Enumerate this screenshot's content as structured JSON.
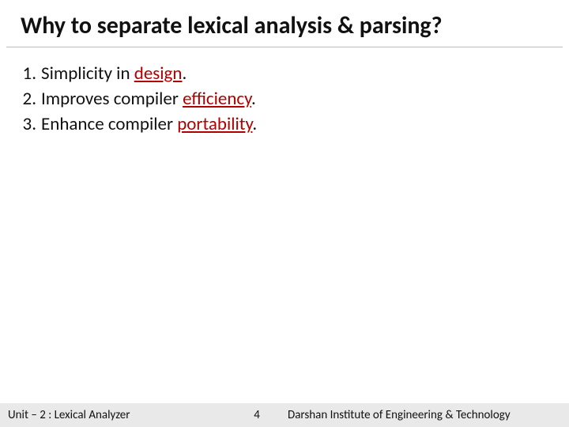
{
  "title": "Why to separate lexical analysis & parsing?",
  "items": [
    {
      "num": "1.",
      "pre": "Simplicity in ",
      "accent": "design",
      "post": "."
    },
    {
      "num": "2.",
      "pre": "Improves compiler ",
      "accent": "efficiency",
      "post": "."
    },
    {
      "num": "3.",
      "pre": "Enhance compiler ",
      "accent": "portability",
      "post": "."
    }
  ],
  "footer": {
    "left": "Unit – 2 : Lexical Analyzer",
    "page": "4",
    "right": "Darshan Institute of Engineering & Technology"
  }
}
